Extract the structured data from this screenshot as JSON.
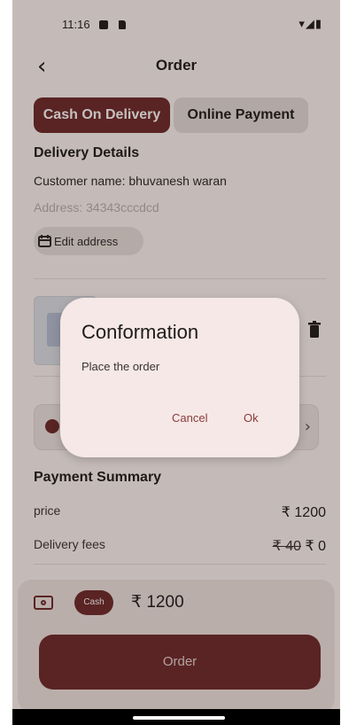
{
  "status_bar": {
    "time": "11:16",
    "right_icons": "▾◢▮"
  },
  "app_bar": {
    "title": "Order",
    "back_icon": "chevron-left-icon"
  },
  "payment_tabs": [
    {
      "label": "Cash On Delivery",
      "selected": true
    },
    {
      "label": "Online Payment",
      "selected": false
    }
  ],
  "delivery": {
    "title": "Delivery Details",
    "customer_line": "Customer name: bhuvanesh waran",
    "address_line": "Address: 34343cccdcd",
    "edit_label": "Edit address"
  },
  "payment_summary": {
    "title": "Payment Summary",
    "price_label": "price",
    "price_value": "₹ 1200",
    "delivery_label": "Delivery fees",
    "delivery_old": "₹ 40",
    "delivery_new": "₹ 0"
  },
  "bottom": {
    "cash_chip": "Cash",
    "total": "₹ 1200",
    "order_button": "Order"
  },
  "dialog": {
    "title": "Conformation",
    "body": "Place the order",
    "cancel": "Cancel",
    "ok": "Ok"
  },
  "colors": {
    "accent": "#6d2a2a",
    "surface": "#fff8f6",
    "dialog": "#f5e8e6"
  }
}
